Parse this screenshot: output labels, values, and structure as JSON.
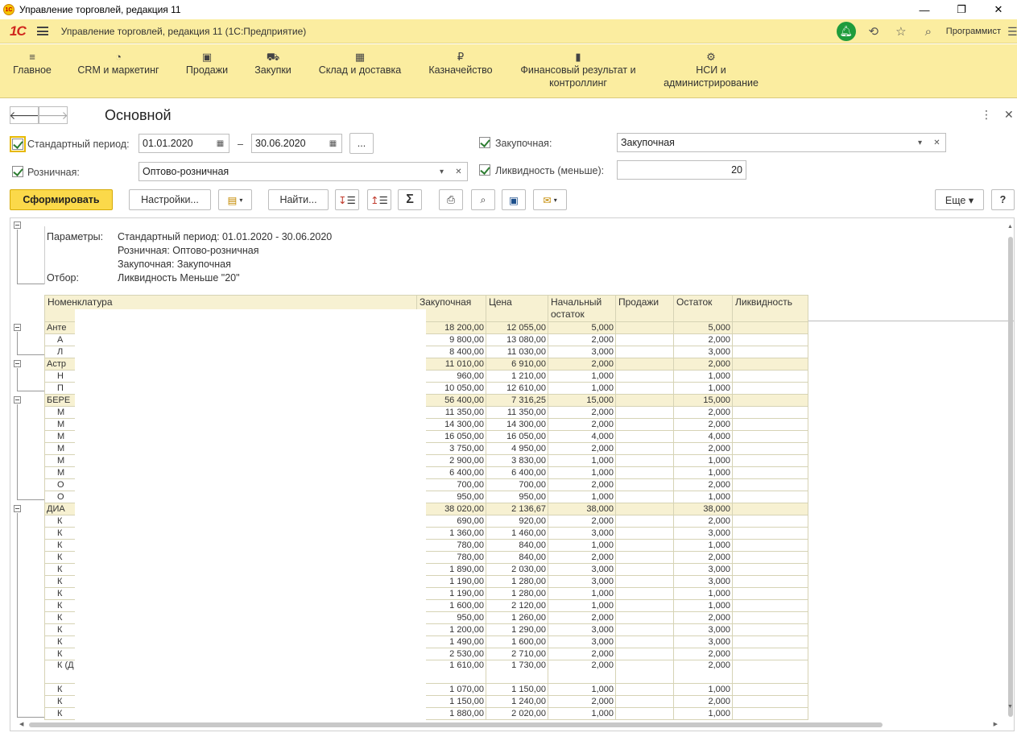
{
  "window": {
    "title": "Управление торговлей, редакция 11",
    "minimize": "—",
    "restore": "❐",
    "close": "✕"
  },
  "topbar": {
    "logo": "1С",
    "app_title": "Управление торговлей, редакция 11  (1С:Предприятие)",
    "user": "Программист",
    "icons": [
      "bell-icon",
      "history-icon",
      "star-icon",
      "search-icon"
    ]
  },
  "sections": [
    {
      "label": "Главное",
      "icon": "≡"
    },
    {
      "label": "CRM и маркетинг",
      "icon": "◔"
    },
    {
      "label": "Продажи",
      "icon": "▣"
    },
    {
      "label": "Закупки",
      "icon": "⛟"
    },
    {
      "label": "Склад и доставка",
      "icon": "▦"
    },
    {
      "label": "Казначейство",
      "icon": "₽"
    },
    {
      "label": "Финансовый результат и контроллинг",
      "icon": "▮"
    },
    {
      "label": "НСИ и администрирование",
      "icon": "⚙"
    }
  ],
  "form": {
    "title": "Основной",
    "back": "🡐",
    "forward": "🡒",
    "more": "⋮",
    "close": "✕",
    "std_period_label": "Стандартный период:",
    "date_from": "01.01.2020",
    "date_to": "30.06.2020",
    "dash": "–",
    "ellipsis": "...",
    "purchase_label": "Закупочная:",
    "purchase_value": "Закупочная",
    "retail_label": "Розничная:",
    "retail_value": "Оптово-розничная",
    "liquidity_label": "Ликвидность (меньше):",
    "liquidity_value": "20",
    "generate": "Сформировать",
    "settings": "Настройки...",
    "find": "Найти...",
    "sum": "Σ",
    "more_btn": "Еще ▾",
    "help": "?"
  },
  "report": {
    "params_label": "Параметры:",
    "params": [
      "Стандартный период: 01.01.2020 - 30.06.2020",
      "Розничная: Оптово-розничная",
      "Закупочная: Закупочная"
    ],
    "filter_label": "Отбор:",
    "filter": "Ликвидность Меньше \"20\"",
    "columns": [
      "Номенклатура",
      "Закупочная",
      "Цена",
      "Начальный остаток",
      "Продажи",
      "Остаток",
      "Ликвидность"
    ],
    "rows": [
      {
        "name": "Анте",
        "g": 1,
        "v": [
          "18 200,00",
          "12 055,00",
          "5,000",
          "",
          "5,000",
          ""
        ]
      },
      {
        "name": "А",
        "v": [
          "9 800,00",
          "13 080,00",
          "2,000",
          "",
          "2,000",
          ""
        ]
      },
      {
        "name": "Л",
        "v": [
          "8 400,00",
          "11 030,00",
          "3,000",
          "",
          "3,000",
          ""
        ]
      },
      {
        "name": "Астр",
        "g": 1,
        "v": [
          "11 010,00",
          "6 910,00",
          "2,000",
          "",
          "2,000",
          ""
        ]
      },
      {
        "name": "Н",
        "v": [
          "960,00",
          "1 210,00",
          "1,000",
          "",
          "1,000",
          ""
        ]
      },
      {
        "name": "П",
        "v": [
          "10 050,00",
          "12 610,00",
          "1,000",
          "",
          "1,000",
          ""
        ]
      },
      {
        "name": "БЕРЕ",
        "g": 1,
        "v": [
          "56 400,00",
          "7 316,25",
          "15,000",
          "",
          "15,000",
          ""
        ]
      },
      {
        "name": "М",
        "v": [
          "11 350,00",
          "11 350,00",
          "2,000",
          "",
          "2,000",
          ""
        ]
      },
      {
        "name": "М",
        "v": [
          "14 300,00",
          "14 300,00",
          "2,000",
          "",
          "2,000",
          ""
        ]
      },
      {
        "name": "М",
        "v": [
          "16 050,00",
          "16 050,00",
          "4,000",
          "",
          "4,000",
          ""
        ]
      },
      {
        "name": "М",
        "v": [
          "3 750,00",
          "4 950,00",
          "2,000",
          "",
          "2,000",
          ""
        ]
      },
      {
        "name": "М",
        "v": [
          "2 900,00",
          "3 830,00",
          "1,000",
          "",
          "1,000",
          ""
        ]
      },
      {
        "name": "М",
        "v": [
          "6 400,00",
          "6 400,00",
          "1,000",
          "",
          "1,000",
          ""
        ]
      },
      {
        "name": "О",
        "v": [
          "700,00",
          "700,00",
          "2,000",
          "",
          "2,000",
          ""
        ]
      },
      {
        "name": "О",
        "v": [
          "950,00",
          "950,00",
          "1,000",
          "",
          "1,000",
          ""
        ]
      },
      {
        "name": "ДИА",
        "g": 1,
        "v": [
          "38 020,00",
          "2 136,67",
          "38,000",
          "",
          "38,000",
          ""
        ]
      },
      {
        "name": "К",
        "v": [
          "690,00",
          "920,00",
          "2,000",
          "",
          "2,000",
          ""
        ]
      },
      {
        "name": "К",
        "v": [
          "1 360,00",
          "1 460,00",
          "3,000",
          "",
          "3,000",
          ""
        ]
      },
      {
        "name": "К",
        "v": [
          "780,00",
          "840,00",
          "1,000",
          "",
          "1,000",
          ""
        ]
      },
      {
        "name": "К",
        "v": [
          "780,00",
          "840,00",
          "2,000",
          "",
          "2,000",
          ""
        ]
      },
      {
        "name": "К",
        "v": [
          "1 890,00",
          "2 030,00",
          "3,000",
          "",
          "3,000",
          ""
        ]
      },
      {
        "name": "К",
        "v": [
          "1 190,00",
          "1 280,00",
          "3,000",
          "",
          "3,000",
          ""
        ]
      },
      {
        "name": "К",
        "v": [
          "1 190,00",
          "1 280,00",
          "1,000",
          "",
          "1,000",
          ""
        ]
      },
      {
        "name": "К",
        "v": [
          "1 600,00",
          "2 120,00",
          "1,000",
          "",
          "1,000",
          ""
        ]
      },
      {
        "name": "К",
        "v": [
          "950,00",
          "1 260,00",
          "2,000",
          "",
          "2,000",
          ""
        ]
      },
      {
        "name": "К",
        "v": [
          "1 200,00",
          "1 290,00",
          "3,000",
          "",
          "3,000",
          ""
        ]
      },
      {
        "name": "К",
        "v": [
          "1 490,00",
          "1 600,00",
          "3,000",
          "",
          "3,000",
          ""
        ]
      },
      {
        "name": "К",
        "v": [
          "2 530,00",
          "2 710,00",
          "2,000",
          "",
          "2,000",
          ""
        ]
      },
      {
        "name": "К (Д",
        "tall": 1,
        "v": [
          "1 610,00",
          "1 730,00",
          "2,000",
          "",
          "2,000",
          ""
        ]
      },
      {
        "name": "К",
        "v": [
          "1 070,00",
          "1 150,00",
          "1,000",
          "",
          "1,000",
          ""
        ]
      },
      {
        "name": "К",
        "v": [
          "1 150,00",
          "1 240,00",
          "2,000",
          "",
          "2,000",
          ""
        ]
      },
      {
        "name": "К",
        "v": [
          "1 880,00",
          "2 020,00",
          "1,000",
          "",
          "1,000",
          ""
        ]
      }
    ]
  }
}
